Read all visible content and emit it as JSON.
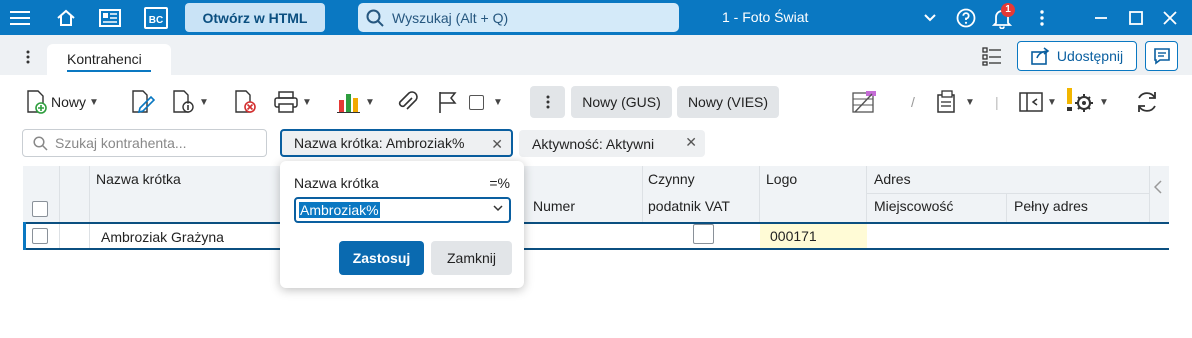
{
  "topbar": {
    "open_html_label": "Otwórz w HTML",
    "search_placeholder": "Wyszukaj (Alt + Q)",
    "app_title": "1 - Foto Świat",
    "notification_count": "1",
    "bc_label": "BC"
  },
  "tabs": {
    "active_tab": "Kontrahenci",
    "share_label": "Udostępnij"
  },
  "toolbar": {
    "new_label": "Nowy",
    "new_gus_label": "Nowy (GUS)",
    "new_vies_label": "Nowy (VIES)"
  },
  "filters": {
    "search_placeholder": "Szukaj kontrahenta...",
    "chip_name": "Nazwa krótka: Ambroziak%",
    "chip_active": "Aktywność: Aktywni"
  },
  "grid": {
    "headers": {
      "short_name": "Nazwa krótka",
      "number": "Numer",
      "vat_line1": "Czynny",
      "vat_line2": "podatnik VAT",
      "logo": "Logo",
      "address": "Adres",
      "city": "Miejscowość",
      "full_address": "Pełny adres"
    },
    "rows": [
      {
        "short_name": "Ambroziak Grażyna",
        "logo": "000171"
      }
    ]
  },
  "popup": {
    "label": "Nazwa krótka",
    "operator": "=%",
    "value": "Ambroziak%",
    "apply_label": "Zastosuj",
    "close_label": "Zamknij"
  },
  "colors": {
    "accent": "#0a78c2",
    "brand_dark": "#0b4f80",
    "notification": "#e53935"
  }
}
